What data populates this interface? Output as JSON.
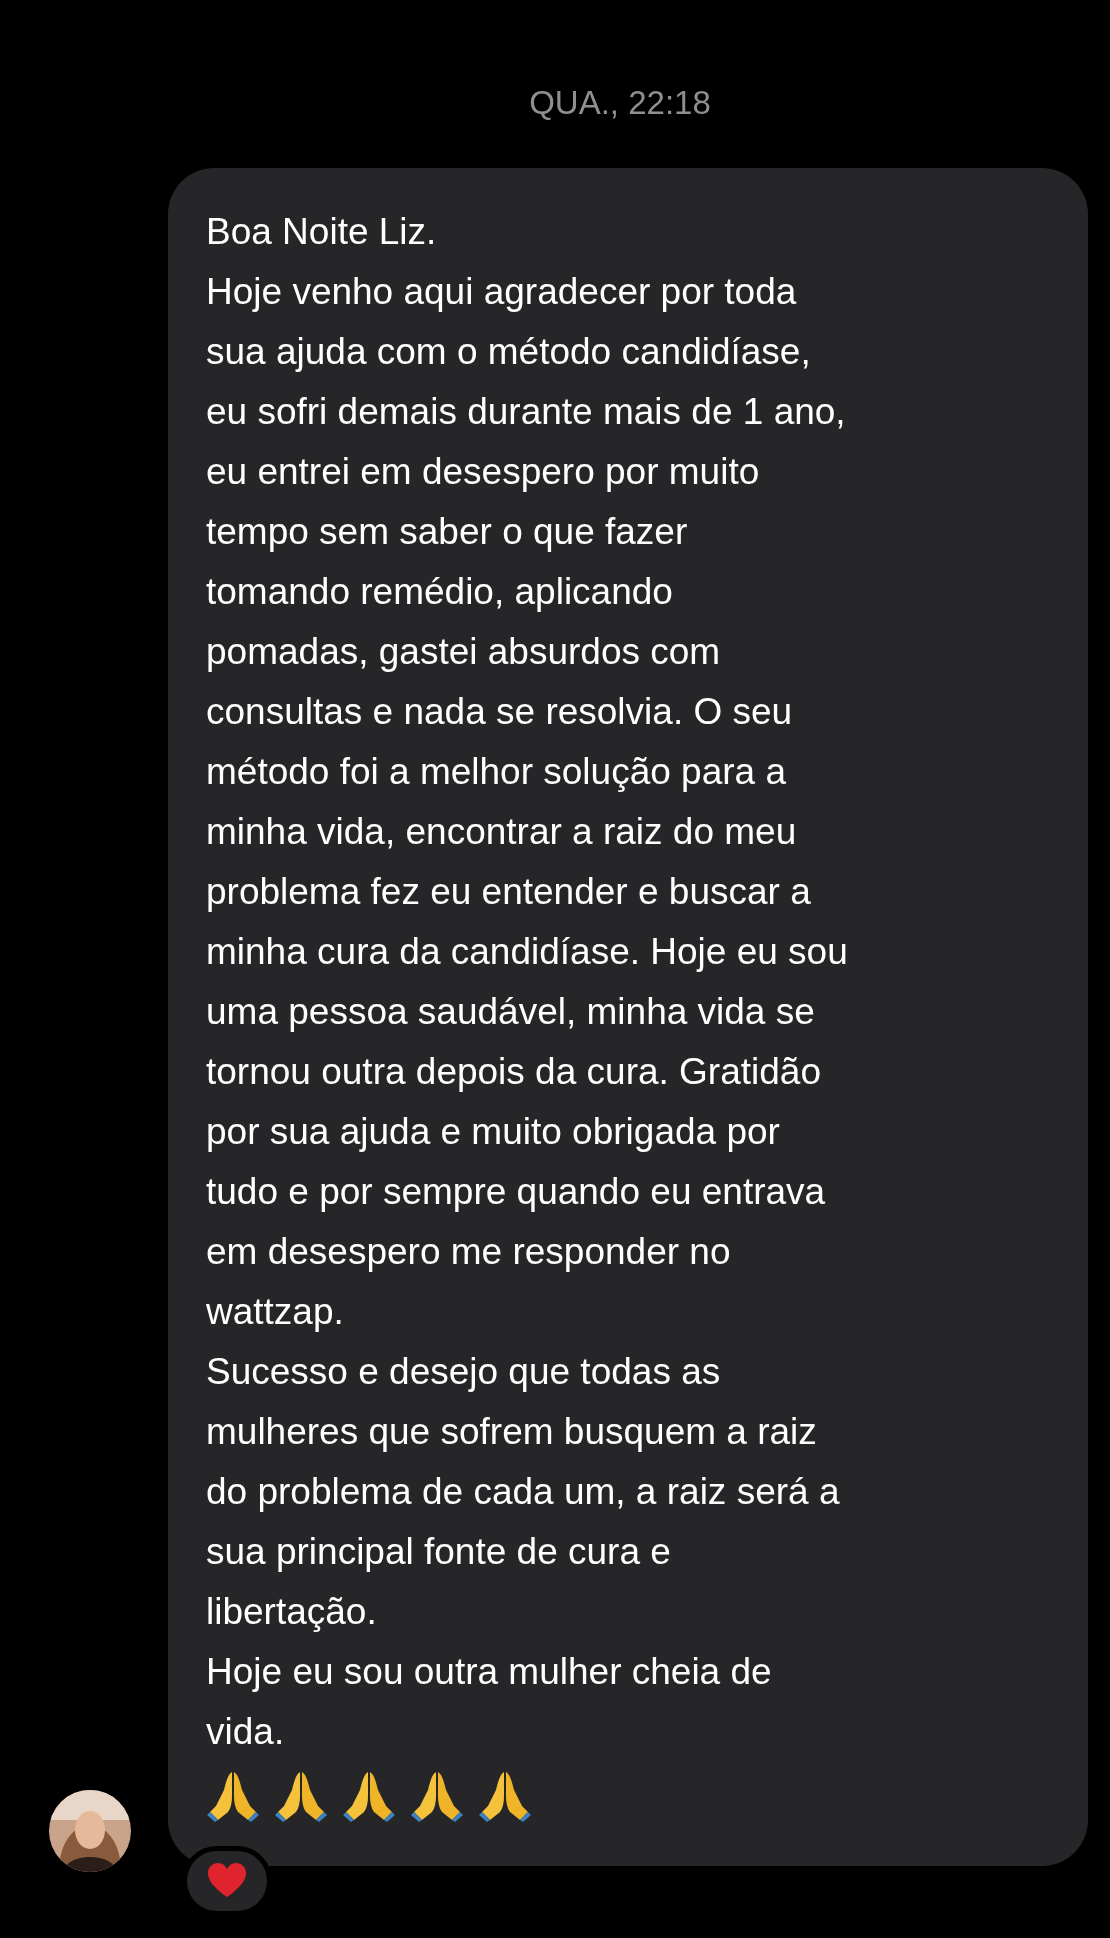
{
  "timestamp": "QUA., 22:18",
  "message": {
    "lines": [
      "Boa Noite Liz.",
      "Hoje venho aqui agradecer por toda",
      "sua ajuda com o método candidíase,",
      "eu sofri demais durante mais de 1 ano,",
      "eu entrei em desespero por muito",
      "tempo sem saber o que fazer",
      "tomando remédio, aplicando",
      "pomadas, gastei absurdos com",
      "consultas e nada se resolvia. O seu",
      "método foi a melhor solução para a",
      "minha vida, encontrar a raiz do meu",
      "problema fez eu entender e buscar a",
      "minha cura da candidíase. Hoje eu sou",
      "uma pessoa saudável, minha vida se",
      "tornou outra depois da cura. Gratidão",
      "por sua ajuda e muito obrigada por",
      "tudo e por sempre quando eu entrava",
      "em desespero me responder no",
      "wattzap.",
      "Sucesso e desejo que todas as",
      "mulheres que sofrem busquem a raiz",
      "do problema de cada um, a raiz será a",
      "sua principal fonte de cura e",
      "libertação.",
      "Hoje eu sou outra mulher cheia de",
      "vida."
    ]
  }
}
